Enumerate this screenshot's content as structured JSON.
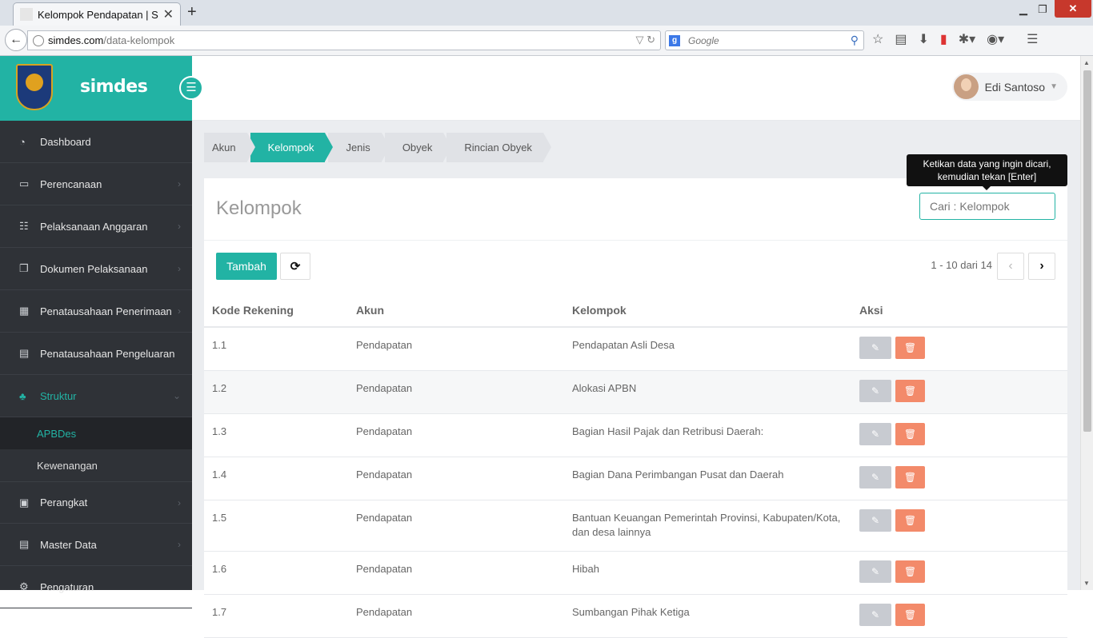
{
  "browser": {
    "tab_title": "Kelompok Pendapatan | Si...",
    "url_host": "simdes.com",
    "url_path": "/data-kelompok",
    "search_placeholder": "Google"
  },
  "sidebar": {
    "app_name": "simdes",
    "items": [
      {
        "label": "Dashboard",
        "icon": "dashboard-icon"
      },
      {
        "label": "Perencanaan",
        "icon": "card-icon"
      },
      {
        "label": "Pelaksanaan Anggaran",
        "icon": "list-icon"
      },
      {
        "label": "Dokumen Pelaksanaan",
        "icon": "documents-icon"
      },
      {
        "label": "Penatausahaan Penerimaan",
        "icon": "table-icon"
      },
      {
        "label": "Penatausahaan Pengeluaran",
        "icon": "table-icon"
      },
      {
        "label": "Struktur",
        "icon": "sitemap-icon"
      },
      {
        "label": "Perangkat",
        "icon": "briefcase-icon"
      },
      {
        "label": "Master Data",
        "icon": "list-icon"
      },
      {
        "label": "Pengaturan",
        "icon": "gear-icon"
      }
    ],
    "sub_items": [
      {
        "label": "APBDes"
      },
      {
        "label": "Kewenangan"
      }
    ]
  },
  "header": {
    "user_name": "Edi Santoso"
  },
  "breadcrumb": [
    "Akun",
    "Kelompok",
    "Jenis",
    "Obyek",
    "Rincian Obyek"
  ],
  "panel": {
    "title": "Kelompok",
    "search_placeholder": "Cari : Kelompok",
    "tooltip_line1": "Ketikan data yang ingin dicari,",
    "tooltip_line2": "kemudian tekan [Enter]",
    "add_label": "Tambah",
    "pager_info": "1 - 10 dari 14"
  },
  "table": {
    "headers": [
      "Kode Rekening",
      "Akun",
      "Kelompok",
      "Aksi"
    ],
    "rows": [
      {
        "kode": "1.1",
        "akun": "Pendapatan",
        "kelompok": "Pendapatan Asli Desa"
      },
      {
        "kode": "1.2",
        "akun": "Pendapatan",
        "kelompok": "Alokasi APBN"
      },
      {
        "kode": "1.3",
        "akun": "Pendapatan",
        "kelompok": "Bagian Hasil Pajak dan Retribusi Daerah:"
      },
      {
        "kode": "1.4",
        "akun": "Pendapatan",
        "kelompok": "Bagian Dana Perimbangan Pusat dan Daerah"
      },
      {
        "kode": "1.5",
        "akun": "Pendapatan",
        "kelompok": "Bantuan Keuangan Pemerintah Provinsi, Kabupaten/Kota, dan desa lainnya"
      },
      {
        "kode": "1.6",
        "akun": "Pendapatan",
        "kelompok": "Hibah"
      },
      {
        "kode": "1.7",
        "akun": "Pendapatan",
        "kelompok": "Sumbangan Pihak Ketiga"
      }
    ]
  },
  "colors": {
    "accent": "#22b3a4",
    "sidebar_bg": "#2f3237",
    "delete": "#f38a6a",
    "edit": "#c8cbd1"
  }
}
